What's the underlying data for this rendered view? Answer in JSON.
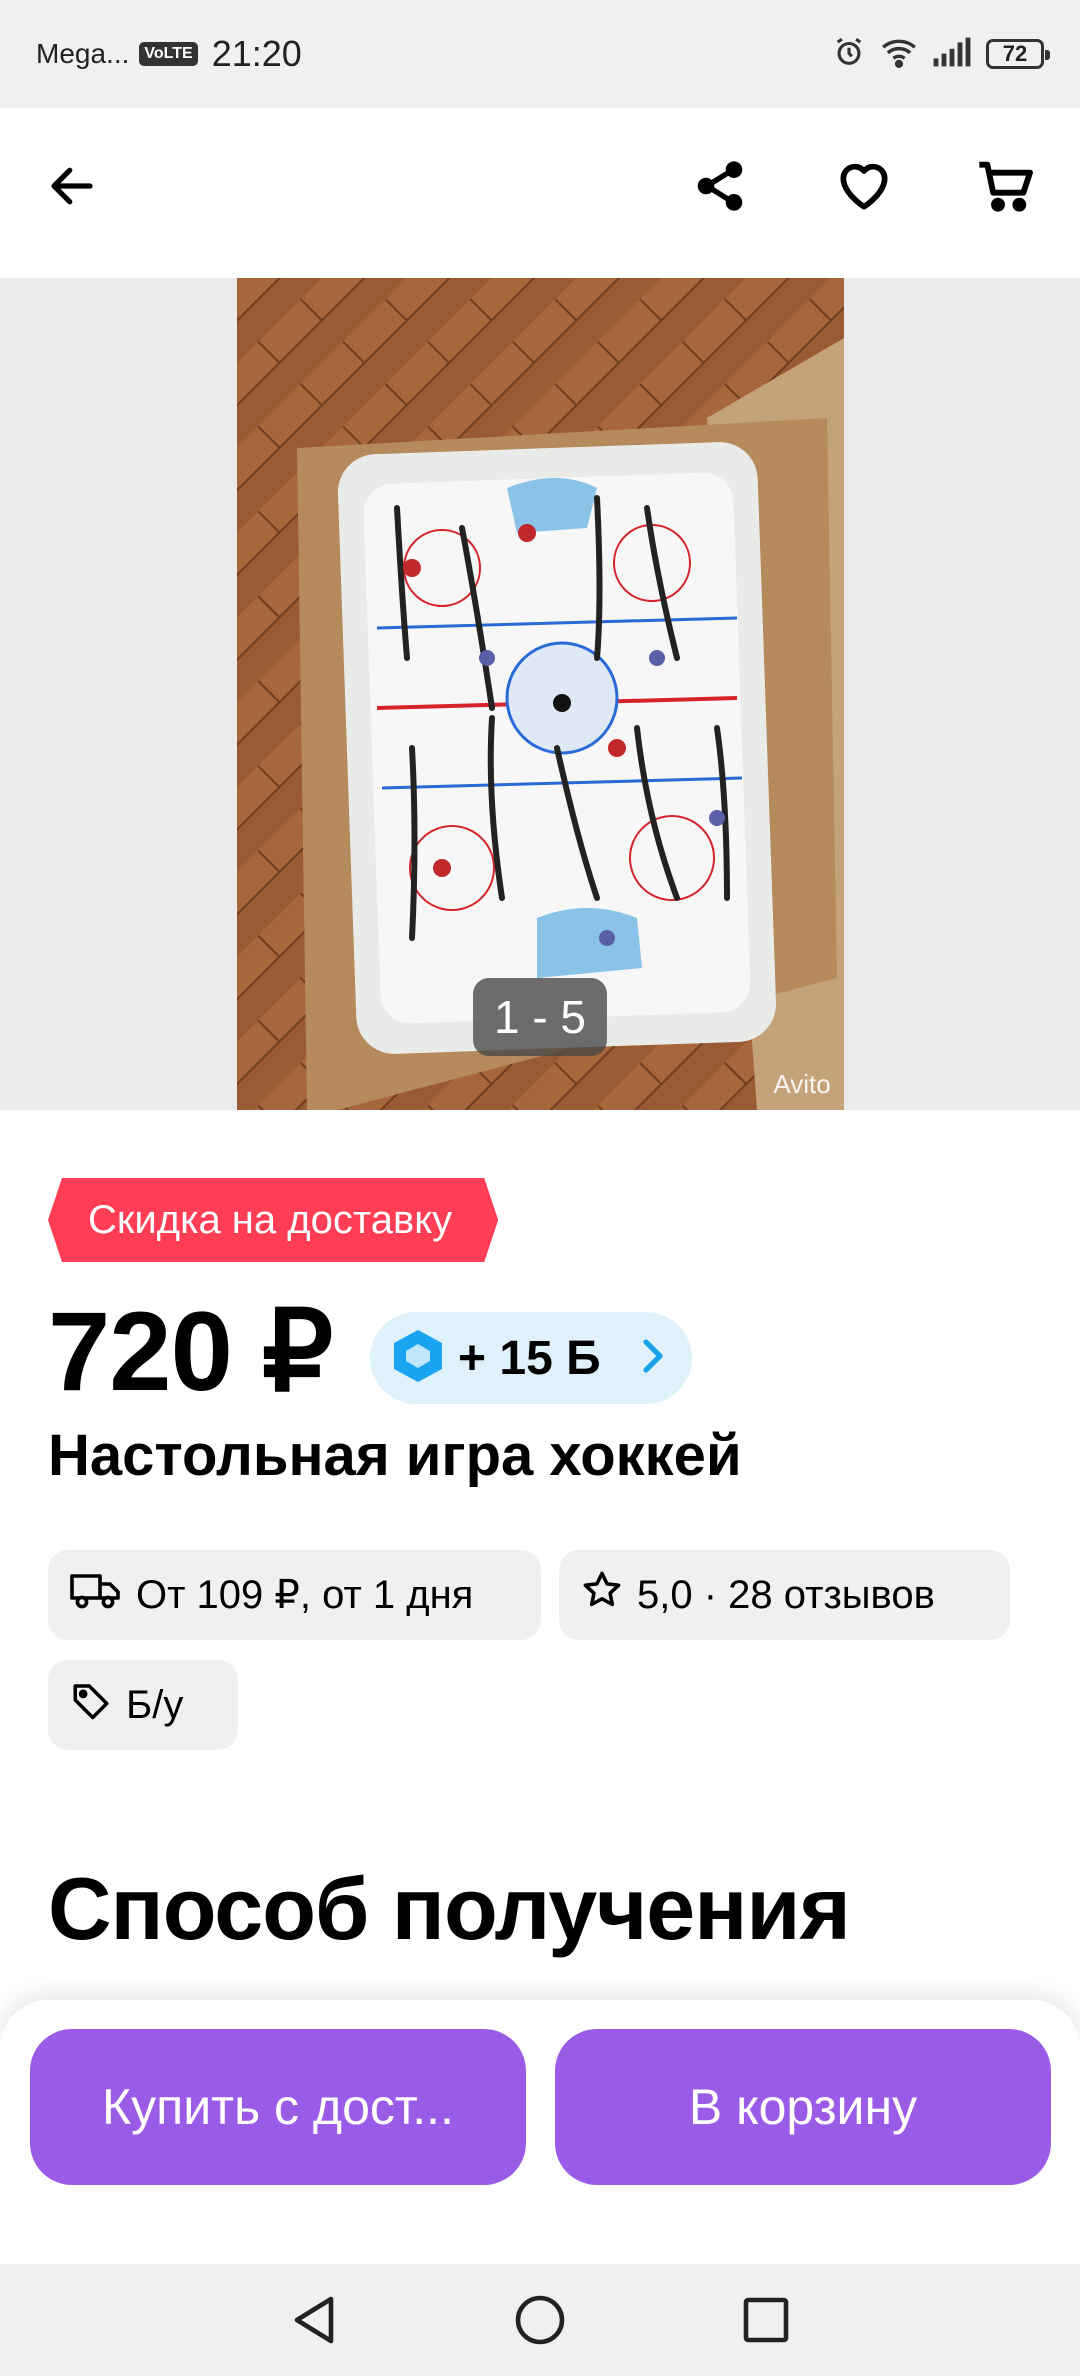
{
  "status_bar": {
    "carrier": "Mega...",
    "volte": "VoLTE",
    "time": "21:20",
    "battery": "72"
  },
  "gallery": {
    "counter": "1 - 5",
    "watermark": "Avito"
  },
  "listing": {
    "badge": "Скидка на доставку",
    "price": "720 ₽",
    "bonus": "+ 15 Б",
    "title": "Настольная игра хоккей"
  },
  "chips": {
    "delivery": "От 109 ₽, от 1 дня",
    "rating": "5,0 · 28 отзывов",
    "condition": "Б/у"
  },
  "section_heading": "Способ получения",
  "actions": {
    "buy": "Купить с дост...",
    "cart": "В корзину"
  },
  "colors": {
    "accent": "#9a5ce6",
    "badge": "#ff3d55",
    "bonus_bg": "#dff1fb"
  }
}
